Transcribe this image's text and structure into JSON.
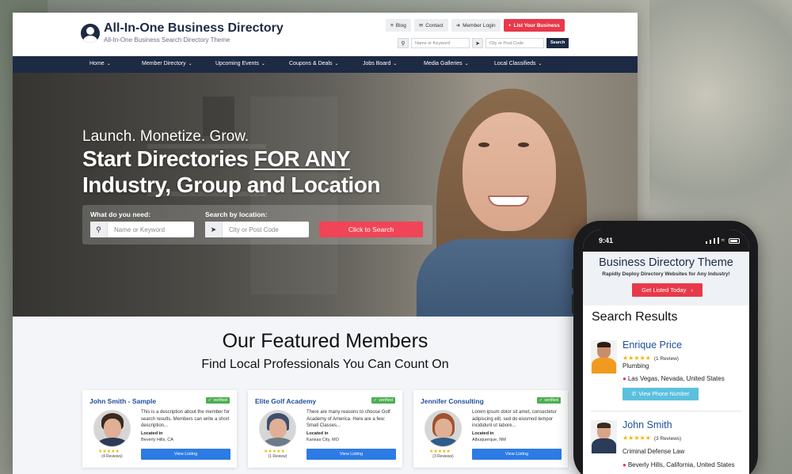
{
  "site": {
    "logo_title": "All-In-One Business Directory",
    "logo_subtitle": "All-In-One Business Search Directory Theme",
    "top_links": [
      {
        "icon": "rss-icon",
        "glyph": "≡",
        "label": "Blog"
      },
      {
        "icon": "envelope-icon",
        "glyph": "✉",
        "label": "Contact"
      },
      {
        "icon": "sign-in-icon",
        "glyph": "➜",
        "label": "Member Login"
      },
      {
        "icon": "plus-icon",
        "glyph": "+",
        "label": "List Your Business"
      }
    ],
    "top_search": {
      "keyword_placeholder": "Name or Keyword",
      "location_placeholder": "City or Post Code",
      "button": "Search"
    },
    "nav": [
      "Home",
      "Member Directory",
      "Upcoming Events",
      "Coupons & Deals",
      "Jobs Board",
      "Media Galleries",
      "Local Classifieds"
    ],
    "hero": {
      "tagline": "Launch. Monetize. Grow.",
      "h1_line1_a": "Start Directories ",
      "h1_line1_b": "FOR ANY",
      "h1_line2": "Industry, Group and Location",
      "what_label": "What do you need:",
      "what_placeholder": "Name or Keyword",
      "where_label": "Search by location:",
      "where_placeholder": "City or Post Code",
      "button": "Click to Search"
    },
    "featured": {
      "title": "Our Featured Members",
      "subtitle": "Find Local Professionals You Can Count On",
      "cards": [
        {
          "name": "John Smith - Sample",
          "verified": "verified",
          "desc": "This is a description about the member for search results. Members can write a short description...",
          "located_label": "Located in",
          "location": "Beverly Hills, CA",
          "stars": "★★★★★",
          "reviews": "(4 Reviews)",
          "button": "View Listing"
        },
        {
          "name": "Elite Golf Academy",
          "verified": "verified",
          "desc": "There are many reasons to choose Golf Academy of America. Here are a few: Small Classes...",
          "located_label": "Located in",
          "location": "Kansas City, MO",
          "stars": "★★★★★",
          "reviews": "(1 Review)",
          "button": "View Listing"
        },
        {
          "name": "Jennifer Consulting",
          "verified": "verified",
          "desc": "Lorem ipsum dolor sit amet, consectetur adipiscing elit, sed do eiusmod tempor incididunt ut labore...",
          "located_label": "Located in",
          "location": "Albuquerque, NM",
          "stars": "★★★★★",
          "reviews": "(3 Reviews)",
          "button": "View Listing"
        }
      ]
    }
  },
  "phone": {
    "time": "9:41",
    "title": "Business Directory Theme",
    "subtitle": "Rapidly Deploy Directory Websites for Any Industry!",
    "cta": "Get Listed Today",
    "results_heading": "Search Results",
    "results": [
      {
        "name": "Enrique Price",
        "stars": "★★★★★",
        "reviews": "(1 Review)",
        "category": "Plumbing",
        "location": "Las Vegas, Nevada, United States",
        "call": "View Phone Number"
      },
      {
        "name": "John Smith",
        "stars": "★★★★★",
        "reviews": "(3 Reviews)",
        "category": "Criminal Defense Law",
        "location": "Beverly Hills, California, United States"
      }
    ]
  },
  "colors": {
    "navy": "#1d2a44",
    "accent_red": "#e8394a",
    "link_blue": "#1f4e9b",
    "button_blue": "#2d7be5",
    "star": "#f5b400",
    "verified_green": "#4caf50"
  }
}
